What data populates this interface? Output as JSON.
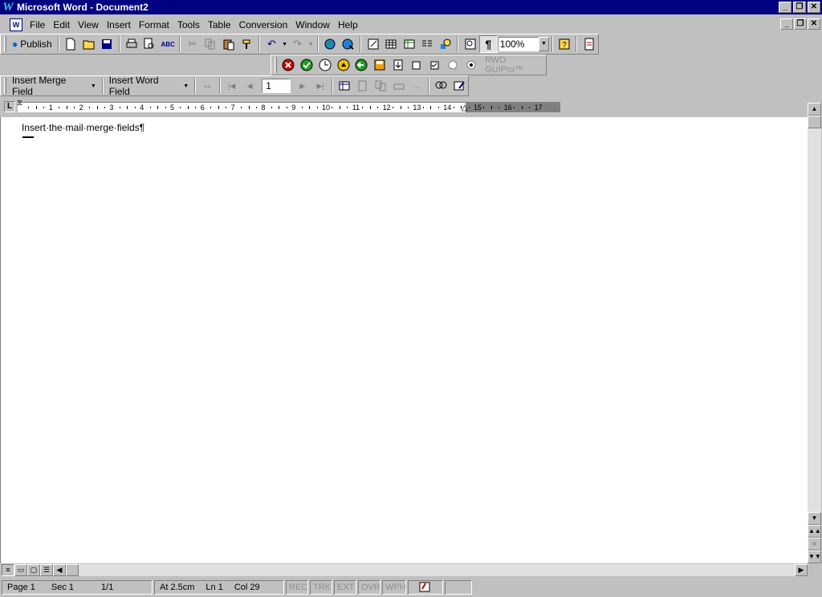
{
  "window": {
    "title": "Microsoft Word - Document2",
    "app_icon_glyph": "W",
    "controls": {
      "minimize": "_",
      "restore": "❐",
      "close": "✕"
    }
  },
  "menu": {
    "items": [
      "File",
      "Edit",
      "View",
      "Insert",
      "Format",
      "Tools",
      "Table",
      "Conversion",
      "Window",
      "Help"
    ]
  },
  "standard_toolbar": {
    "publish_label": "Publish",
    "zoom_value": "100%",
    "icons": [
      "new-document-icon",
      "open-folder-icon",
      "save-disk-icon",
      "print-icon",
      "print-preview-icon",
      "spelling-icon",
      "cut-icon",
      "copy-icon",
      "paste-icon",
      "format-painter-icon",
      "undo-icon",
      "redo-icon",
      "web-toolbar-icon",
      "insert-hyperlink-icon",
      "tables-borders-icon",
      "insert-table-icon",
      "insert-excel-icon",
      "columns-icon",
      "drawing-icon",
      "document-map-icon",
      "show-hide-icon",
      "help-icon",
      "pdf-icon"
    ]
  },
  "rwd_toolbar": {
    "label": "RWD GUIPro™",
    "icons": [
      "stop-icon",
      "check-icon",
      "clock-icon",
      "record-icon",
      "back-icon",
      "save-icon",
      "insert-icon",
      "checkbox-unchecked-icon",
      "checkbox-checked-icon",
      "radio-unselected-icon",
      "radio-selected-icon"
    ]
  },
  "merge_toolbar": {
    "insert_merge_field_label": "Insert Merge Field",
    "insert_word_field_label": "Insert Word Field",
    "record_number": "1"
  },
  "ruler": {
    "tab_selector": "L",
    "numbers": [
      "1",
      "2",
      "3",
      "4",
      "5",
      "6",
      "7",
      "8",
      "9",
      "10",
      "11",
      "12",
      "13",
      "14",
      "15",
      "16",
      "17"
    ]
  },
  "document": {
    "paragraph_text": "Insert·the·mail·merge·fields¶"
  },
  "status_bar": {
    "page": "Page 1",
    "section": "Sec 1",
    "page_of": "1/1",
    "at": "At 2.5cm",
    "line": "Ln 1",
    "column": "Col 29",
    "modes": [
      "REC",
      "TRK",
      "EXT",
      "OVR",
      "WPH"
    ]
  }
}
